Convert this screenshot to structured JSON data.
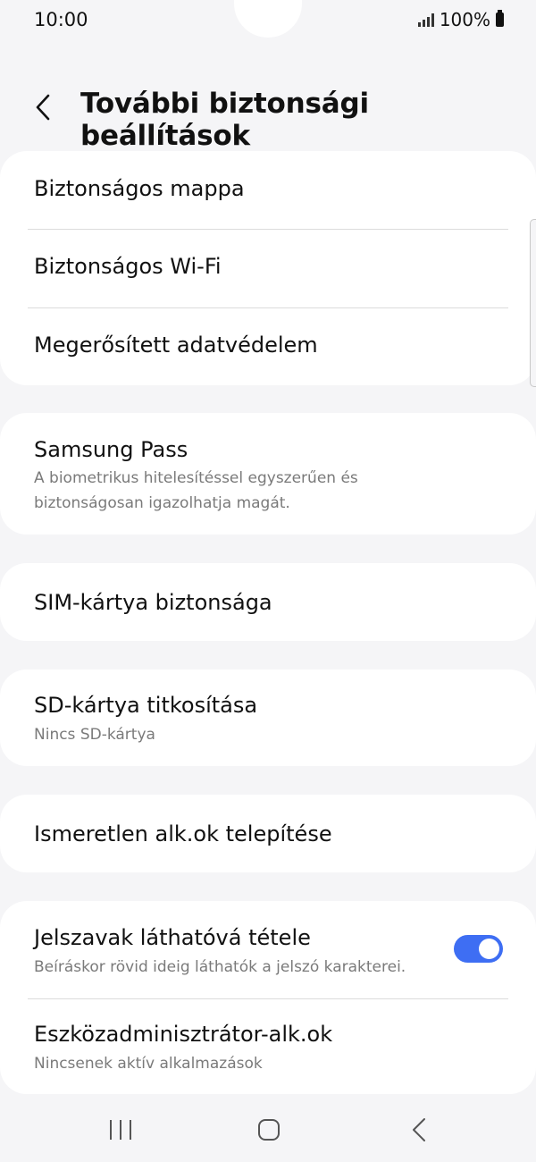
{
  "status_bar": {
    "time": "10:00",
    "battery_percent": "100%"
  },
  "header": {
    "title": "További biztonsági beállítások",
    "back_icon": "chevron-left-icon"
  },
  "group1": {
    "items": [
      {
        "label": "Biztonságos mappa"
      },
      {
        "label": "Biztonságos Wi-Fi"
      },
      {
        "label": "Megerősített adatvédelem"
      }
    ]
  },
  "samsung_pass": {
    "label": "Samsung Pass",
    "sub_line1": "A biometrikus hitelesítéssel egyszerűen és",
    "sub_line2": "biztonságosan igazolhatja magát."
  },
  "sim_security": {
    "label": "SIM-kártya biztonsága"
  },
  "sd_encryption": {
    "label": "SD-kártya titkosítása",
    "sub": "Nincs SD-kártya"
  },
  "unknown_apps": {
    "label": "Ismeretlen alk.ok telepítése"
  },
  "group_last": {
    "password_visibility": {
      "label": "Jelszavak láthatóvá tétele",
      "sub": "Beíráskor rövid ideig láthatók a jelszó karakterei.",
      "toggle_on": true
    },
    "device_admin": {
      "label": "Eszközadminisztrátor-alk.ok",
      "sub": "Nincsenek aktív alkalmazások"
    }
  },
  "colors": {
    "accent": "#3e6ef3",
    "background": "#f5f5f7",
    "card": "#ffffff",
    "secondary_text": "#7a7a7a"
  },
  "nav_bar": {
    "icons": [
      "recent-apps-icon",
      "home-icon",
      "back-icon"
    ]
  }
}
